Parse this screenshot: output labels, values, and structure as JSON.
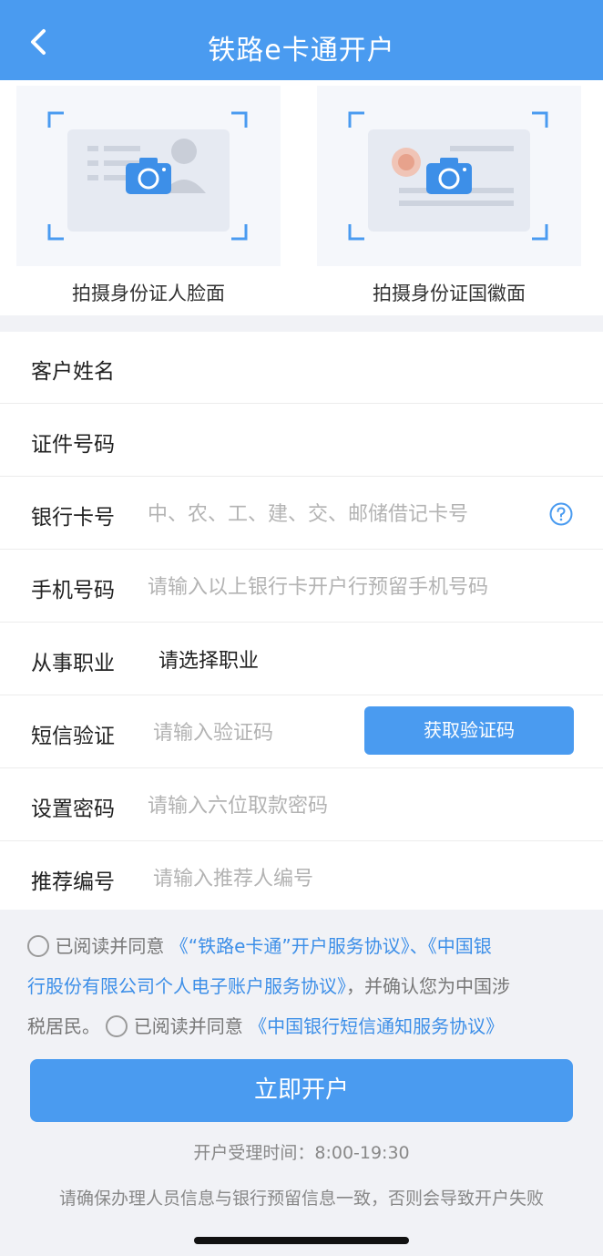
{
  "header": {
    "title": "铁路e卡通开户"
  },
  "upload": {
    "front_caption": "拍摄身份证人脸面",
    "back_caption": "拍摄身份证国徽面"
  },
  "form": {
    "name": {
      "label": "客户姓名",
      "placeholder": ""
    },
    "id_number": {
      "label": "证件号码",
      "placeholder": ""
    },
    "bank_card": {
      "label": "银行卡号",
      "placeholder": "中、农、工、建、交、邮储借记卡号"
    },
    "phone": {
      "label": "手机号码",
      "placeholder": "请输入以上银行卡开户行预留手机号码"
    },
    "occupation": {
      "label": "从事职业",
      "value": "请选择职业"
    },
    "sms": {
      "label": "短信验证",
      "placeholder": "请输入验证码",
      "button": "获取验证码"
    },
    "password": {
      "label": "设置密码",
      "placeholder": "请输入六位取款密码"
    },
    "referrer": {
      "label": "推荐编号",
      "placeholder": "请输入推荐人编号"
    }
  },
  "agreement": {
    "read_agree_1": "已阅读并同意",
    "link_1a": "《“铁路e卡通”开户服务协议》、《中国银",
    "link_1b": "行股份有限公司个人电子账户服务协议》",
    "confirm_text": "，并确认您为中国涉",
    "confirm_text_2": "税居民。",
    "read_agree_2": "已阅读并同意",
    "link_2": "《中国银行短信通知服务协议》"
  },
  "submit_label": "立即开户",
  "hours_text": "开户受理时间：8:00-19:30",
  "notice_text": "请确保办理人员信息与银行预留信息一致，否则会导致开户失败",
  "colors": {
    "primary": "#4a9bf0",
    "link": "#3d8fe8",
    "background": "#f1f2f6"
  },
  "icons": [
    "back-arrow-icon",
    "camera-icon",
    "help-question-icon",
    "radio-icon"
  ]
}
